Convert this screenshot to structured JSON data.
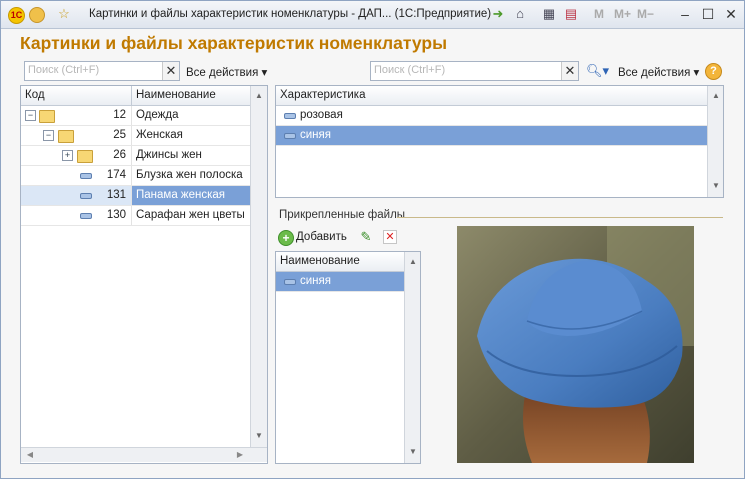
{
  "window": {
    "title": "Картинки и файлы характеристик номенклатуры - ДАП... (1С:Предприятие)",
    "logo_text": "1С",
    "mem_buttons": [
      "M",
      "M+",
      "M−"
    ]
  },
  "heading": "Картинки и файлы характеристик номенклатуры",
  "left_panel": {
    "search_placeholder": "Поиск (Ctrl+F)",
    "all_actions": "Все действия ▾",
    "columns": [
      "Код",
      "Наименование"
    ],
    "rows": [
      {
        "code": "12",
        "name": "Одежда",
        "type": "folder",
        "level": 0,
        "toggle": "−"
      },
      {
        "code": "25",
        "name": "Женская",
        "type": "folder",
        "level": 1,
        "toggle": "−"
      },
      {
        "code": "26",
        "name": "Джинсы жен",
        "type": "folder",
        "level": 2,
        "toggle": "+"
      },
      {
        "code": "174",
        "name": "Блузка жен полоска",
        "type": "item",
        "level": 3
      },
      {
        "code": "131",
        "name": "Панама женская",
        "type": "item",
        "level": 3,
        "selected": true
      },
      {
        "code": "130",
        "name": "Сарафан жен цветы",
        "type": "item",
        "level": 3
      }
    ]
  },
  "right_panel": {
    "search_placeholder": "Поиск (Ctrl+F)",
    "all_actions": "Все действия ▾",
    "help": "?",
    "columns": [
      "Характеристика"
    ],
    "rows": [
      {
        "name": "розовая",
        "selected": false
      },
      {
        "name": "синяя",
        "selected": true
      }
    ]
  },
  "attached_files": {
    "group_title": "Прикрепленные файлы",
    "add_label": "Добавить",
    "columns": [
      "Наименование"
    ],
    "rows": [
      {
        "name": "синяя",
        "selected": true
      }
    ]
  },
  "colors": {
    "heading": "#c07a00",
    "selection": "#7aa0d7",
    "hat": "#4a7dc0"
  }
}
